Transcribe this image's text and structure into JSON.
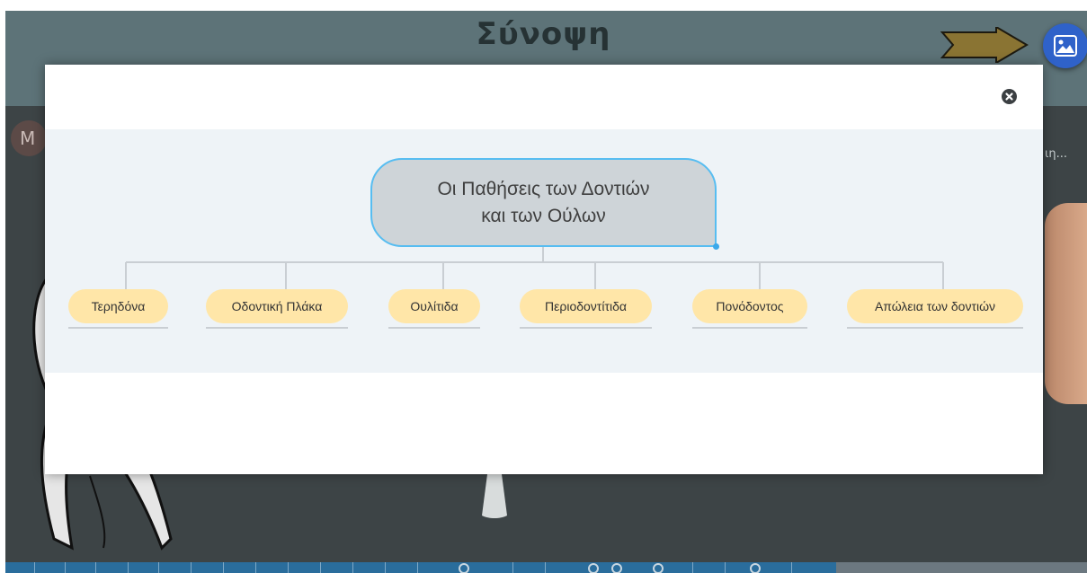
{
  "header": {
    "title": "Σύνοψη",
    "accent_color": "#2f62c9",
    "background_color": "#5d7378"
  },
  "image_button": {
    "icon": "image-icon"
  },
  "next_arrow": {
    "icon": "arrow-right-icon",
    "color": "#8a7433"
  },
  "avatar": {
    "initial": "M"
  },
  "side_text": "ιη...",
  "modal": {
    "close_icon": "close-icon",
    "mindmap": {
      "root": "Οι Παθήσεις των Δοντιών\nκαι των Ούλων",
      "children": [
        "Τερηδόνα",
        "Οδοντική Πλάκα",
        "Ουλίτιδα",
        "Περιοδοντίτιδα",
        "Πονόδοντος",
        "Απώλεια των δοντιών"
      ],
      "root_color": "#ced4d8",
      "root_border_color": "#57bdf1",
      "child_color": "#ffe6a8"
    }
  }
}
